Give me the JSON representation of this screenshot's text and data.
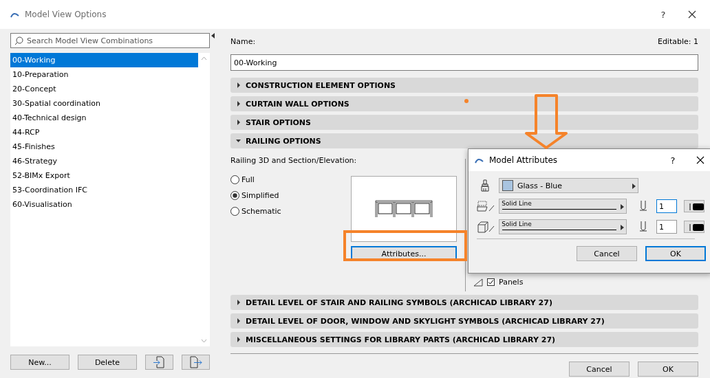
{
  "window": {
    "title": "Model View Options",
    "help": "?"
  },
  "search": {
    "placeholder": "Search Model View Combinations"
  },
  "combinations": [
    {
      "label": "00-Working",
      "selected": true
    },
    {
      "label": "10-Preparation",
      "selected": false
    },
    {
      "label": "20-Concept",
      "selected": false
    },
    {
      "label": "30-Spatial coordination",
      "selected": false
    },
    {
      "label": "40-Technical design",
      "selected": false
    },
    {
      "label": "44-RCP",
      "selected": false
    },
    {
      "label": "45-Finishes",
      "selected": false
    },
    {
      "label": "46-Strategy",
      "selected": false
    },
    {
      "label": "52-BIMx Export",
      "selected": false
    },
    {
      "label": "53-Coordination IFC",
      "selected": false
    },
    {
      "label": "60-Visualisation",
      "selected": false
    }
  ],
  "list_buttons": [
    {
      "kind": "text",
      "label": "New..."
    },
    {
      "kind": "text",
      "label": "Delete"
    },
    {
      "kind": "import"
    },
    {
      "kind": "export"
    }
  ],
  "name": {
    "label": "Name:",
    "editable": "Editable: 1",
    "value": "00-Working"
  },
  "sections": [
    {
      "title": "CONSTRUCTION ELEMENT OPTIONS",
      "expanded": false
    },
    {
      "title": "CURTAIN WALL OPTIONS",
      "expanded": false
    },
    {
      "title": "STAIR OPTIONS",
      "expanded": false
    },
    {
      "title": "RAILING OPTIONS",
      "expanded": true
    },
    {
      "title": "DETAIL LEVEL OF STAIR AND RAILING SYMBOLS (ARCHICAD LIBRARY 27)",
      "expanded": false
    },
    {
      "title": "DETAIL LEVEL OF DOOR, WINDOW AND SKYLIGHT SYMBOLS (ARCHICAD LIBRARY 27)",
      "expanded": false
    },
    {
      "title": "MISCELLANEOUS SETTINGS FOR LIBRARY PARTS (ARCHICAD LIBRARY 27)",
      "expanded": false
    }
  ],
  "railing": {
    "label": "Railing 3D and Section/Elevation:",
    "options": [
      {
        "label": "Full",
        "selected": false
      },
      {
        "label": "Simplified",
        "selected": true
      },
      {
        "label": "Schematic",
        "selected": false
      }
    ],
    "attributes_button": "Attributes...",
    "panels": {
      "label": "Panels",
      "checked": true
    }
  },
  "footer_buttons": [
    "Cancel",
    "OK"
  ],
  "attributes_dialog": {
    "title": "Model Attributes",
    "help": "?",
    "material": "Glass - Blue",
    "lines": [
      {
        "kind": "cut",
        "label": "Solid Line",
        "pen": "1",
        "focused": true
      },
      {
        "kind": "uncut",
        "label": "Solid Line",
        "pen": "1",
        "focused": false
      }
    ],
    "buttons": [
      {
        "label": "Cancel",
        "default": false
      },
      {
        "label": "OK",
        "default": true
      }
    ]
  }
}
